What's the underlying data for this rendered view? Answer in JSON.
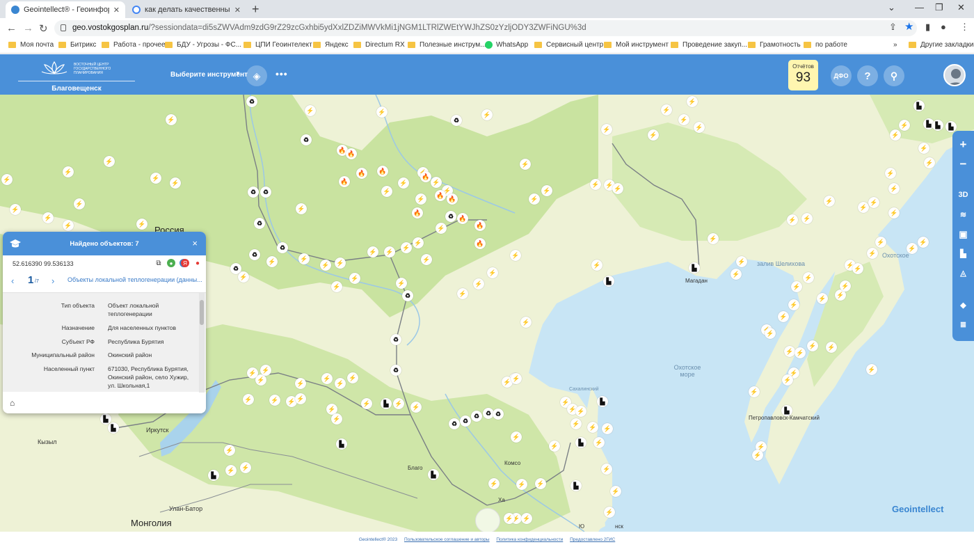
{
  "browser": {
    "tabs": [
      {
        "title": "Geointellect® - Геоинформаци",
        "active": true
      },
      {
        "title": "как делать качественные сним",
        "active": false
      }
    ],
    "url_host": "geo.vostokgosplan.ru",
    "url_rest": "/?sessiondata=di5sZWVAdm9zdG9rZ29zcGxhbi5ydXxlZDZiMWVkMi1jNGM1LTRlZWEtYWJhZS0zYzljODY3ZWFiNGU%3d",
    "bookmarks": [
      {
        "label": "Моя почта",
        "type": "folder"
      },
      {
        "label": "Битрикс",
        "type": "folder"
      },
      {
        "label": "Работа - прочее",
        "type": "folder"
      },
      {
        "label": "БДУ - Угрозы - ФС...",
        "type": "folder"
      },
      {
        "label": "ЦПИ Геоинтелект",
        "type": "folder"
      },
      {
        "label": "Яндекс",
        "type": "folder"
      },
      {
        "label": "Directum RX",
        "type": "folder"
      },
      {
        "label": "Полезные инструм...",
        "type": "folder"
      },
      {
        "label": "WhatsApp",
        "type": "whatsapp"
      },
      {
        "label": "Сервисный центр",
        "type": "folder"
      },
      {
        "label": "Мой инструмент",
        "type": "folder"
      },
      {
        "label": "Проведение закуп...",
        "type": "folder"
      },
      {
        "label": "Грамотность",
        "type": "folder"
      },
      {
        "label": "по работе",
        "type": "folder"
      }
    ],
    "bookmarks_more": "»",
    "other_bookmarks": "Другие закладки"
  },
  "header": {
    "logo_text": "Восточный центр государственного планирования",
    "city": "Благовещенск",
    "tool_select": "Выберите инструмент",
    "reports_label": "Отчётов",
    "reports_count": "93",
    "dfo_label": "ДФО",
    "help_label": "?"
  },
  "map": {
    "labels": [
      {
        "text": "Россия",
        "kind": "big"
      },
      {
        "text": "Монголия",
        "kind": "big"
      },
      {
        "text": "Иркутск",
        "kind": "city"
      },
      {
        "text": "Кызыл",
        "kind": "city"
      },
      {
        "text": "Улан-Батор",
        "kind": "city"
      },
      {
        "text": "Магадан",
        "kind": "city"
      },
      {
        "text": "Благо",
        "kind": "city"
      },
      {
        "text": "Комсо",
        "kind": "city"
      },
      {
        "text": "Ха",
        "kind": "city"
      },
      {
        "text": "Ю",
        "kind": "city"
      },
      {
        "text": "нск",
        "kind": "city"
      },
      {
        "text": "Сахалинский",
        "kind": "city"
      },
      {
        "text": "Петропавловск-Камчатский",
        "kind": "city"
      },
      {
        "text": "Охотское море",
        "kind": "sea"
      },
      {
        "text": "залив Шелихова",
        "kind": "sea"
      },
      {
        "text": "Охотское",
        "kind": "sea"
      }
    ],
    "marker_types": {
      "power": "⚡",
      "recycle": "♻",
      "fire": "🔥",
      "factory": "▙"
    }
  },
  "rail": {
    "zoom_in": "+",
    "zoom_out": "−",
    "mode_3d": "3D"
  },
  "panel": {
    "title": "Найдено объектов: 7",
    "close": "×",
    "coords": "52.616390 99.536133",
    "page_current": "1",
    "page_total": "/7",
    "layer_name": "Объекты локальной теплогенерации (данны...",
    "attributes": [
      {
        "key": "Тип объекта",
        "value": "Объект локальной теплогенерации"
      },
      {
        "key": "Назначение",
        "value": "Для населенных пунктов"
      },
      {
        "key": "Субъект РФ",
        "value": "Республика Бурятия"
      },
      {
        "key": "Муниципальный район",
        "value": "Окинский район"
      },
      {
        "key": "Населенный пункт",
        "value": "671030, Республика Бурятия, Окинский район, село Хужир, ул. Школьная,1"
      }
    ]
  },
  "footer": {
    "copyright": "Geointellect® 2023",
    "terms": "Пользовательское соглашение и авторы",
    "privacy": "Политика конфиденциальности",
    "provided": "Предоставлено 2ГИС"
  },
  "brand": "Geointellect",
  "colors": {
    "header_blue": "#4a90d9",
    "land": "#eef2d6",
    "forest": "#c9e3a0",
    "sea": "#c8e5f5",
    "reports_bg": "#fff6b0"
  }
}
